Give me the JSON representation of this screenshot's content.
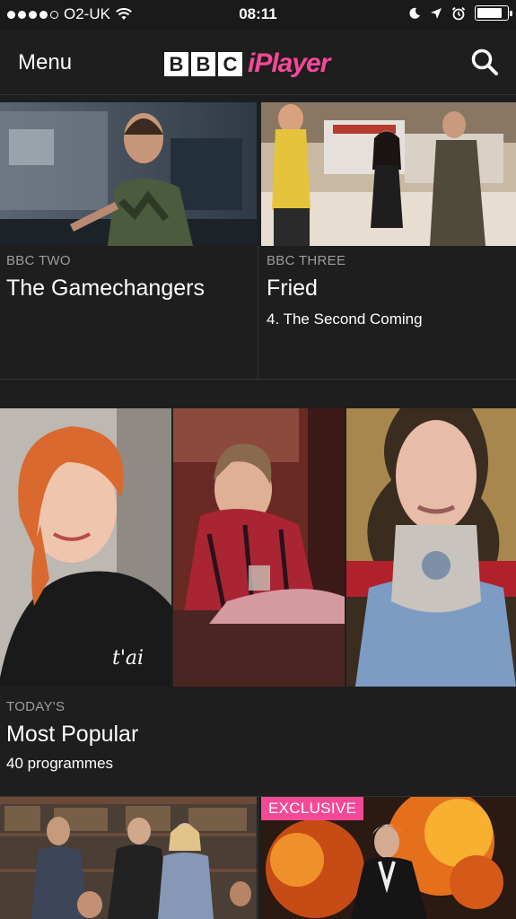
{
  "status_bar": {
    "carrier": "O2-UK",
    "time": "08:11",
    "battery_level": 0.85
  },
  "nav": {
    "menu_label": "Menu",
    "brand_blocks": [
      "B",
      "B",
      "C"
    ],
    "brand_text": "iPlayer"
  },
  "featured": [
    {
      "channel": "BBC TWO",
      "title": "The Gamechangers",
      "subtitle": ""
    },
    {
      "channel": "BBC THREE",
      "title": "Fried",
      "subtitle": "4. The Second Coming"
    }
  ],
  "popular": {
    "kicker": "TODAY'S",
    "title": "Most Popular",
    "count": "40 programmes"
  },
  "bottom": {
    "badge": "EXCLUSIVE"
  }
}
